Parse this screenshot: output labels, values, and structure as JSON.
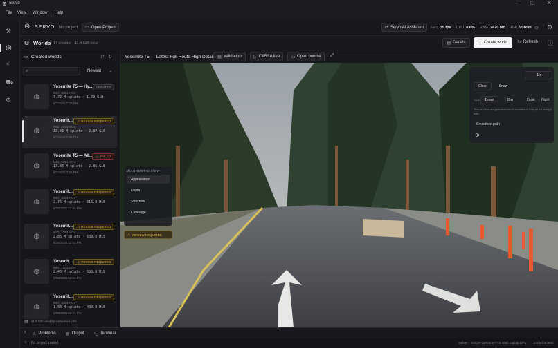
{
  "app": {
    "title": "Servo"
  },
  "menu": [
    "File",
    "View",
    "Window",
    "Help"
  ],
  "topbar": {
    "brand": "SERVO",
    "project": "No project",
    "open_project": "Open Project",
    "assistant": "Servo AI Assistant",
    "fps_label": "FPS",
    "fps_value": "35 fps",
    "cpu_label": "CPU",
    "cpu_value": "0.6%",
    "ram_label": "RAM",
    "ram_value": "2420 MB",
    "rhi_label": "RHI",
    "rhi_value": "Vulkan"
  },
  "secbar": {
    "section": "Worlds",
    "summary": "17 created · 11.4 GiB local",
    "details": "Details",
    "create": "Create world",
    "refresh": "Refresh"
  },
  "sidebar": {
    "header": "Created worlds",
    "sort_count": "17",
    "sort": "Newest",
    "search_placeholder": "",
    "footer": "11.4 GiB used by completed jobs",
    "worlds": [
      {
        "title": "Yosemite T5 — Hy...",
        "file": "IMG_1004.MOV",
        "stats": "7.72 M splats · 1.79 GiB",
        "date": "8/7/2026 7:29 PM",
        "status": "UNRATED",
        "status_kind": "unrated"
      },
      {
        "title": "Yosemit...",
        "file": "IMG_1004.MOV",
        "stats": "13.83 M splats · 2.87 GiB",
        "date": "8/7/2026 7:28 PM",
        "status": "REVIEW REQUIRED",
        "status_kind": "review"
      },
      {
        "title": "Yosemite T5 — All...",
        "file": "IMG_1004.MOV",
        "stats": "13.83 M splats · 2.86 GiB",
        "date": "8/7/2026 7:41 PM",
        "status": "FAILED",
        "status_kind": "failed"
      },
      {
        "title": "Yosemit...",
        "file": "IMG_1004.MOV",
        "stats": "2.76 M splats · 616.9 MiB",
        "date": "8/28/2025 12:51 PM",
        "status": "REVIEW REQUIRED",
        "status_kind": "review"
      },
      {
        "title": "Yosemit...",
        "file": "IMG_1004.MOV",
        "stats": "2.86 M splats · 639.6 MiB",
        "date": "8/28/2025 12:51 PM",
        "status": "REVIEW REQUIRED",
        "status_kind": "review"
      },
      {
        "title": "Yosemit...",
        "file": "IMG_1004.MOV",
        "stats": "2.46 M splats · 590.8 MiB",
        "date": "8/28/2025 12:51 PM",
        "status": "REVIEW REQUIRED",
        "status_kind": "review"
      },
      {
        "title": "Yosemit...",
        "file": "IMG_1004.MOV",
        "stats": "1.98 M splats · 439.9 MiB",
        "date": "8/28/2025 12:51 PM",
        "status": "REVIEW REQUIRED",
        "status_kind": "review"
      }
    ]
  },
  "viewbar": {
    "world_title": "Yosemite T5 — Latest Full Route High Detail v2",
    "validation": "Validation",
    "carla": "CARLA live",
    "bundle": "Open bundle"
  },
  "diagnostic": {
    "title": "DIAGNOSTIC VIEW",
    "items": [
      "Appearance",
      "Depth",
      "Structure",
      "Coverage"
    ],
    "review": "REVIEW REQUIRED"
  },
  "env_panel": {
    "speed": "1x",
    "weather": [
      "Clear",
      "Snow"
    ],
    "time_label": "TIME",
    "times": [
      "Dawn",
      "Day",
      "Dusk",
      "Night"
    ],
    "note": "Time and sun are generated visual simulations; they do not change depth",
    "note2": "truth",
    "smoothed": "Smoothed path"
  },
  "bottomtabs": [
    "Problems",
    "Output",
    "Terminal"
  ],
  "status": {
    "left": "No project loaded",
    "gpu": "Vulkan · NVIDIA GeForce RTX 4060 Laptop GPU",
    "right": "Local frontend"
  },
  "colors": {
    "accent_review": "#e3b13b",
    "failed": "#e06a6a",
    "selected_card": "#25272c"
  }
}
